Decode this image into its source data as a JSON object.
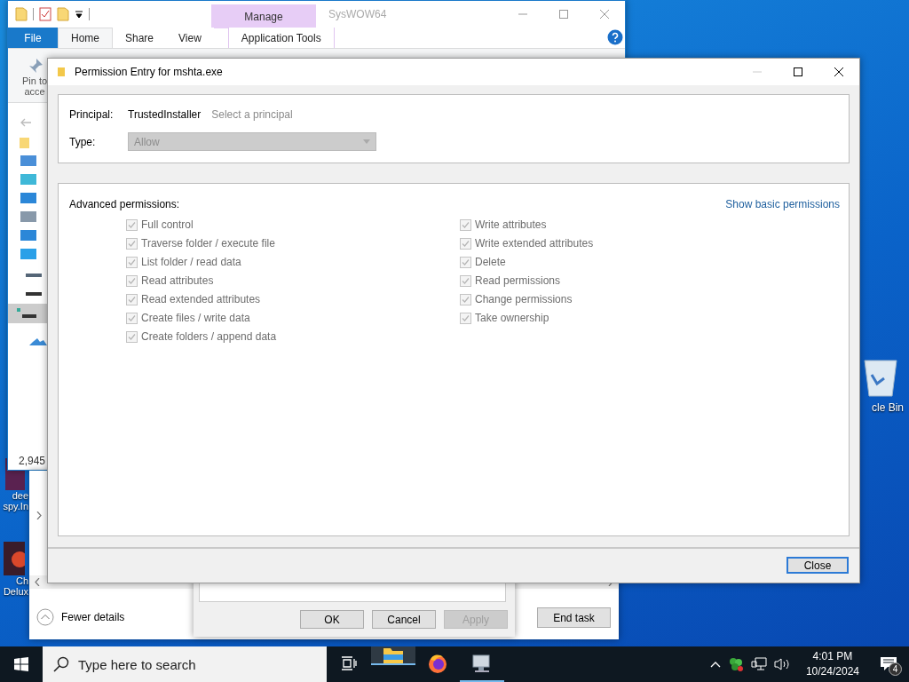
{
  "desktop": {
    "icons": [
      {
        "lines": [
          "dee",
          "spy.In"
        ],
        "kind": "file"
      },
      {
        "lines": [
          "Ch",
          "Delux"
        ],
        "kind": "game"
      }
    ],
    "recycle_bin": {
      "label": "cle Bin"
    }
  },
  "explorer": {
    "title": "SysWOW64",
    "contextual_header": "Manage",
    "tabs": [
      {
        "label": "File",
        "kind": "file",
        "selected": false
      },
      {
        "label": "Home",
        "kind": "tab",
        "selected": true
      },
      {
        "label": "Share",
        "kind": "tab",
        "selected": false
      },
      {
        "label": "View",
        "kind": "tab",
        "selected": false
      },
      {
        "label": "Application Tools",
        "kind": "contextual",
        "selected": false
      }
    ],
    "ribbon_texts": [
      "Pin to",
      "acce"
    ],
    "item_count": "2,945"
  },
  "task_manager": {
    "fewer_details": "Fewer details",
    "end_task": "End task"
  },
  "properties_dialog": {
    "buttons": [
      {
        "label": "OK",
        "disabled": false
      },
      {
        "label": "Cancel",
        "disabled": false
      },
      {
        "label": "Apply",
        "disabled": true
      }
    ]
  },
  "permission_entry": {
    "title": "Permission Entry for mshta.exe",
    "principal_label": "Principal:",
    "principal_value": "TrustedInstaller",
    "select_principal": "Select a principal",
    "type_label": "Type:",
    "type": {
      "value": "Allow",
      "disabled": true
    },
    "section_label": "Advanced permissions:",
    "show_basic": "Show basic permissions",
    "permissions": [
      [
        {
          "label": "Full control",
          "checked": true,
          "disabled": true
        },
        {
          "label": "Traverse folder / execute file",
          "checked": true,
          "disabled": true
        },
        {
          "label": "List folder / read data",
          "checked": true,
          "disabled": true
        },
        {
          "label": "Read attributes",
          "checked": true,
          "disabled": true
        },
        {
          "label": "Read extended attributes",
          "checked": true,
          "disabled": true
        },
        {
          "label": "Create files / write data",
          "checked": true,
          "disabled": true
        },
        {
          "label": "Create folders / append data",
          "checked": true,
          "disabled": true
        }
      ],
      [
        {
          "label": "Write attributes",
          "checked": true,
          "disabled": true
        },
        {
          "label": "Write extended attributes",
          "checked": true,
          "disabled": true
        },
        {
          "label": "Delete",
          "checked": true,
          "disabled": true
        },
        {
          "label": "Read permissions",
          "checked": true,
          "disabled": true
        },
        {
          "label": "Change permissions",
          "checked": true,
          "disabled": true
        },
        {
          "label": "Take ownership",
          "checked": true,
          "disabled": true
        }
      ]
    ],
    "close": "Close"
  },
  "taskbar": {
    "search_placeholder": "Type here to search",
    "apps": [
      {
        "kind": "taskview",
        "selected": false
      },
      {
        "kind": "explorer",
        "selected": true
      },
      {
        "kind": "firefox",
        "selected": false
      },
      {
        "kind": "monitor",
        "selected": false
      }
    ],
    "time": "4:01 PM",
    "date": "10/24/2024",
    "notifications": "4"
  }
}
